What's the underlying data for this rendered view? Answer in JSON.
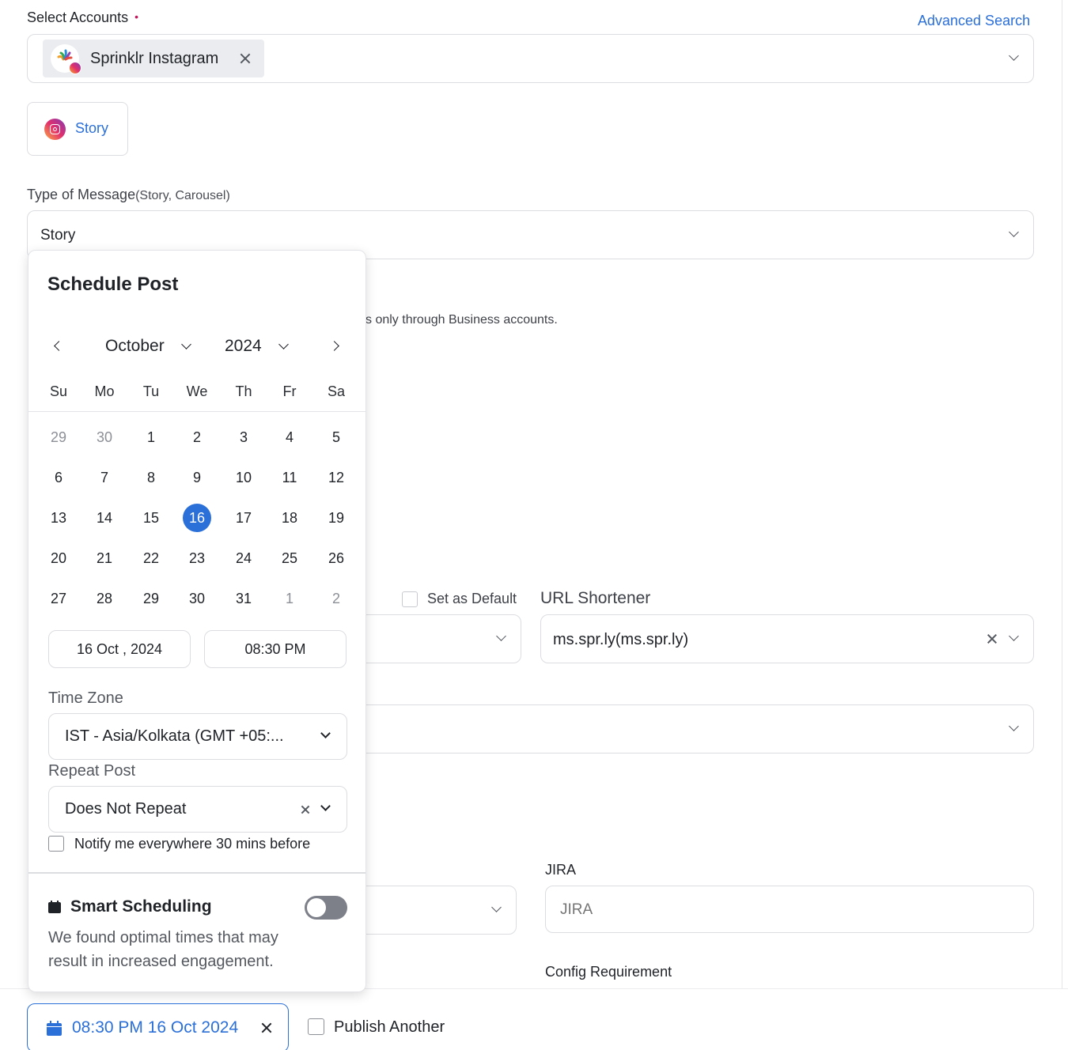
{
  "accounts": {
    "label": "Select Accounts",
    "required_marker": "•",
    "advanced_search": "Advanced Search",
    "selected": [
      {
        "name": "Sprinklr Instagram",
        "network": "instagram"
      }
    ]
  },
  "post_type_chip": {
    "label": "Story",
    "icon": "instagram-icon"
  },
  "type_of_message": {
    "label": "Type of Message",
    "hint": "(Story, Carousel)",
    "value": "Story"
  },
  "business_notice": "s only through Business accounts.",
  "set_as_default": {
    "label": "Set as Default",
    "checked": false
  },
  "url_shortener": {
    "label": "URL Shortener",
    "value": "ms.spr.ly(ms.spr.ly)"
  },
  "jira": {
    "label": "JIRA",
    "placeholder": "JIRA"
  },
  "config_requirement": {
    "label": "Config Requirement"
  },
  "schedule_popup": {
    "title": "Schedule Post",
    "month": "October",
    "year": "2024",
    "weekdays": [
      "Su",
      "Mo",
      "Tu",
      "We",
      "Th",
      "Fr",
      "Sa"
    ],
    "weeks": [
      [
        {
          "d": "29",
          "m": true
        },
        {
          "d": "30",
          "m": true
        },
        {
          "d": "1"
        },
        {
          "d": "2"
        },
        {
          "d": "3"
        },
        {
          "d": "4"
        },
        {
          "d": "5"
        }
      ],
      [
        {
          "d": "6"
        },
        {
          "d": "7"
        },
        {
          "d": "8"
        },
        {
          "d": "9"
        },
        {
          "d": "10"
        },
        {
          "d": "11"
        },
        {
          "d": "12"
        }
      ],
      [
        {
          "d": "13"
        },
        {
          "d": "14"
        },
        {
          "d": "15"
        },
        {
          "d": "16",
          "s": true
        },
        {
          "d": "17"
        },
        {
          "d": "18"
        },
        {
          "d": "19"
        }
      ],
      [
        {
          "d": "20"
        },
        {
          "d": "21"
        },
        {
          "d": "22"
        },
        {
          "d": "23"
        },
        {
          "d": "24"
        },
        {
          "d": "25"
        },
        {
          "d": "26"
        }
      ],
      [
        {
          "d": "27"
        },
        {
          "d": "28"
        },
        {
          "d": "29"
        },
        {
          "d": "30"
        },
        {
          "d": "31"
        },
        {
          "d": "1",
          "m": true
        },
        {
          "d": "2",
          "m": true
        }
      ]
    ],
    "date_value": "16 Oct , 2024",
    "time_value": "08:30 PM",
    "time_zone_label": "Time Zone",
    "time_zone_value": "IST - Asia/Kolkata (GMT +05:...",
    "repeat_label": "Repeat Post",
    "repeat_value": "Does Not Repeat",
    "notify_label": "Notify me everywhere 30 mins before",
    "notify_checked": false,
    "smart_scheduling_title": "Smart Scheduling",
    "smart_scheduling_enabled": false,
    "smart_scheduling_desc_1": "We found optimal times that may",
    "smart_scheduling_desc_2": "result in increased engagement."
  },
  "footer": {
    "schedule_chip": "08:30 PM 16 Oct 2024",
    "publish_another": "Publish Another",
    "publish_another_checked": false
  },
  "colors": {
    "accent": "#2b6fd8",
    "required": "#c2185b"
  }
}
